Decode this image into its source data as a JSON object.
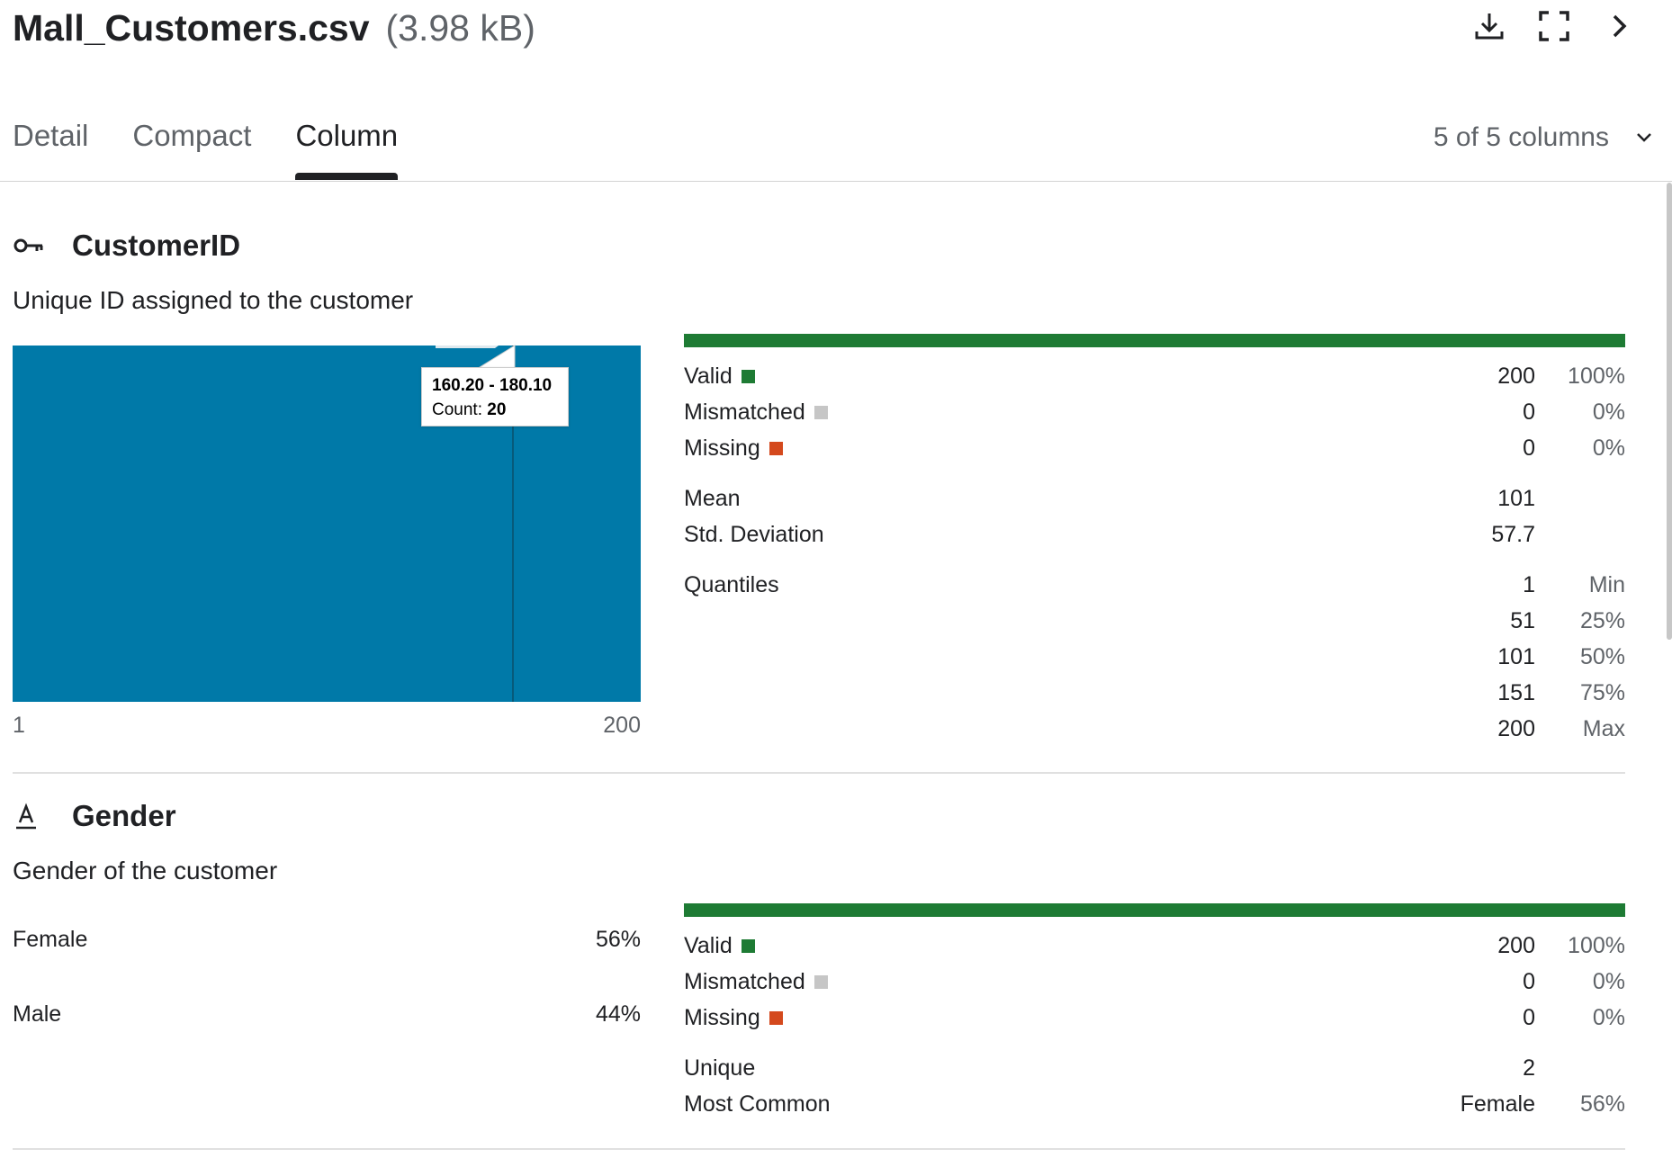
{
  "header": {
    "file_name": "Mall_Customers.csv",
    "file_size": "(3.98 kB)",
    "icons": [
      "download-icon",
      "fullscreen-icon",
      "chevron-right-icon"
    ]
  },
  "tabs": [
    {
      "label": "Detail",
      "active": false
    },
    {
      "label": "Compact",
      "active": false
    },
    {
      "label": "Column",
      "active": true
    }
  ],
  "columns_selector": "5 of 5 columns",
  "colors": {
    "accent": "#0079a8",
    "valid": "#1e7b34",
    "mismatched": "#c6c6c6",
    "missing": "#d4491d"
  },
  "columns": [
    {
      "name": "CustomerID",
      "icon": "key-icon",
      "description": "Unique ID assigned to the customer",
      "histogram": {
        "x_min_label": "1",
        "x_max_label": "200",
        "tooltip_range": "160.20 - 180.10",
        "tooltip_count_label": "Count:",
        "tooltip_count": "20"
      },
      "stats": {
        "valid": {
          "label": "Valid",
          "value": "200",
          "pct": "100%"
        },
        "mismatched": {
          "label": "Mismatched",
          "value": "0",
          "pct": "0%"
        },
        "missing": {
          "label": "Missing",
          "value": "0",
          "pct": "0%"
        },
        "mean": {
          "label": "Mean",
          "value": "101"
        },
        "std": {
          "label": "Std. Deviation",
          "value": "57.7"
        },
        "quantiles_label": "Quantiles",
        "quantiles": [
          {
            "value": "1",
            "label": "Min"
          },
          {
            "value": "51",
            "label": "25%"
          },
          {
            "value": "101",
            "label": "50%"
          },
          {
            "value": "151",
            "label": "75%"
          },
          {
            "value": "200",
            "label": "Max"
          }
        ]
      }
    },
    {
      "name": "Gender",
      "icon": "text-type-icon",
      "description": "Gender of the customer",
      "categories": [
        {
          "label": "Female",
          "pct": "56%"
        },
        {
          "label": "Male",
          "pct": "44%"
        }
      ],
      "stats": {
        "valid": {
          "label": "Valid",
          "value": "200",
          "pct": "100%"
        },
        "mismatched": {
          "label": "Mismatched",
          "value": "0",
          "pct": "0%"
        },
        "missing": {
          "label": "Missing",
          "value": "0",
          "pct": "0%"
        },
        "unique": {
          "label": "Unique",
          "value": "2"
        },
        "most_common": {
          "label": "Most Common",
          "value": "Female",
          "pct": "56%"
        }
      }
    }
  ]
}
